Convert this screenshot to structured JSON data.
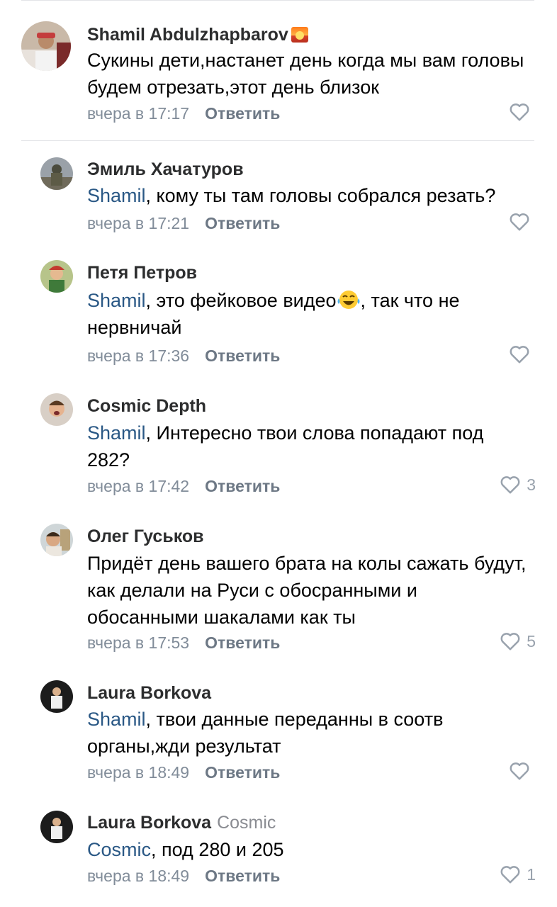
{
  "colors": {
    "mention": "#2a5885",
    "meta": "#818c99",
    "divider": "#e3e4e8"
  },
  "comments": [
    {
      "author": "Shamil Abdulzhapbarov",
      "badge": "sunset-emoji",
      "text": "Сукины дети,настанет день когда мы вам головы будем отрезать,этот день близок",
      "time": "вчера в 17:17",
      "reply": "Ответить",
      "likes": ""
    },
    {
      "author": "Эмиль Хачатуров",
      "mention": "Shamil",
      "text": ", кому ты там головы собрался резать?",
      "time": "вчера в 17:21",
      "reply": "Ответить",
      "likes": ""
    },
    {
      "author": "Петя Петров",
      "mention": "Shamil",
      "text": ", это фейковое видео",
      "text_after": ", так что не нервничай",
      "emoji": "laughing-tears-emoji",
      "time": "вчера в 17:36",
      "reply": "Ответить",
      "likes": ""
    },
    {
      "author": "Cosmic Depth",
      "mention": "Shamil",
      "text": ", Интересно твои слова попадают под 282?",
      "time": "вчера в 17:42",
      "reply": "Ответить",
      "likes": "3"
    },
    {
      "author": "Олег Гуськов",
      "text": "Придёт день вашего брата на колы сажать будут, как делали на Руси с обосранными и обосанными шакалами как ты",
      "time": "вчера в 17:53",
      "reply": "Ответить",
      "likes": "5"
    },
    {
      "author": "Laura Borkova",
      "mention": "Shamil",
      "text": ", твои данные переданны в соотв органы,жди результат",
      "time": "вчера в 18:49",
      "reply": "Ответить",
      "likes": ""
    },
    {
      "author": "Laura Borkova",
      "reply_to": "Cosmic",
      "mention": "Cosmic",
      "text": ", под 280 и 205",
      "time": "вчера в 18:49",
      "reply": "Ответить",
      "likes": "1"
    }
  ]
}
